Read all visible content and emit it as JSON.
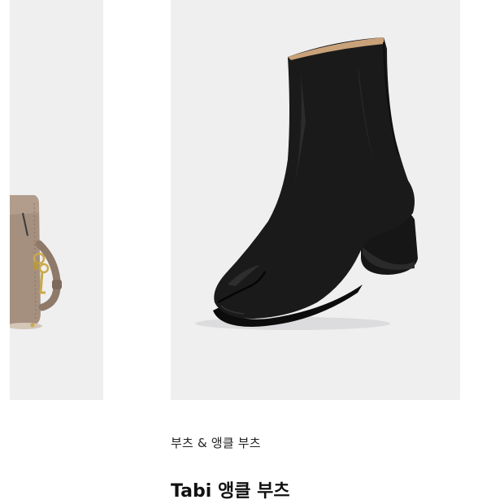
{
  "products": [
    {
      "image_icon": "handbag-image",
      "category": "",
      "title": ""
    },
    {
      "image_icon": "ankle-boot-image",
      "category": "부츠 & 앵클 부츠",
      "title": "Tabi 앵클 부츠"
    }
  ],
  "colors": {
    "card_background": "#efeff0",
    "boot_leather": "#1a1a1a",
    "bag_leather": "#a58f7e"
  }
}
